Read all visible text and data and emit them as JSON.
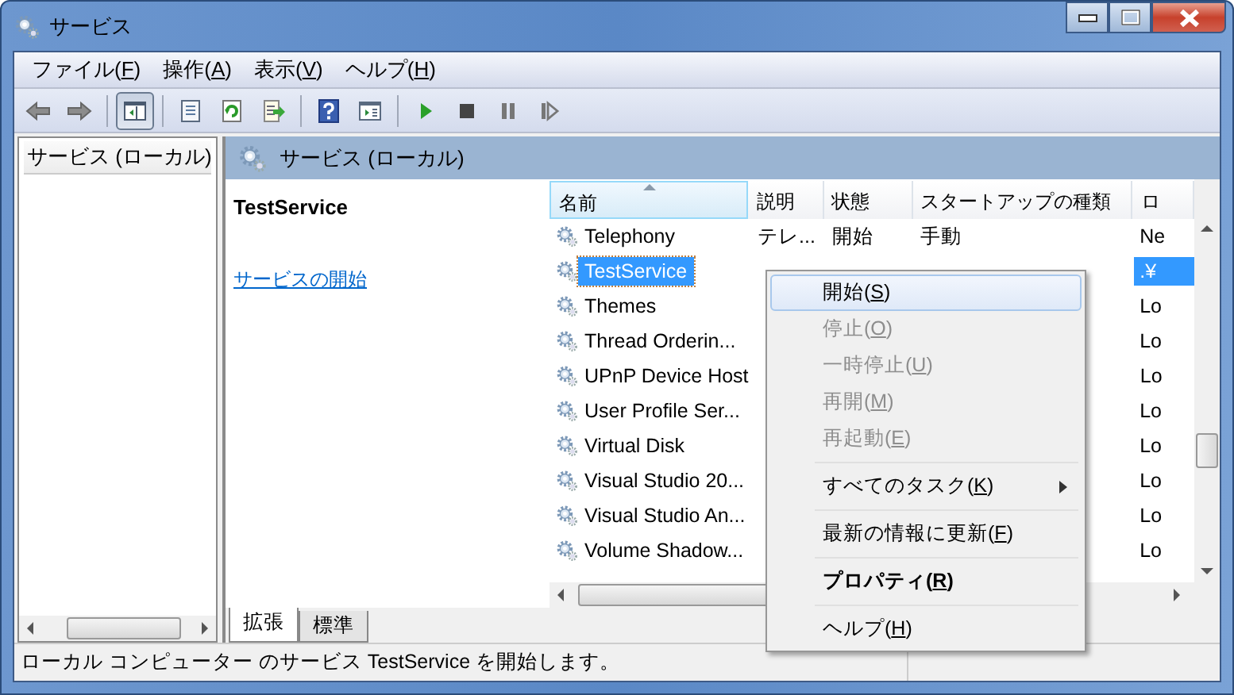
{
  "window": {
    "title": "サービス"
  },
  "menu_bar": [
    {
      "parts": [
        "ファイル(",
        "F",
        ")"
      ]
    },
    {
      "parts": [
        "操作(",
        "A",
        ")"
      ]
    },
    {
      "parts": [
        "表示(",
        "V",
        ")"
      ]
    },
    {
      "parts": [
        "ヘルプ(",
        "H",
        ")"
      ]
    }
  ],
  "toolbar": [
    {
      "kind": "back",
      "pressed": false
    },
    {
      "kind": "forward",
      "pressed": false
    },
    {
      "kind": "separator"
    },
    {
      "kind": "tree",
      "pressed": true
    },
    {
      "kind": "separator"
    },
    {
      "kind": "properties",
      "pressed": false
    },
    {
      "kind": "refresh",
      "pressed": false
    },
    {
      "kind": "export",
      "pressed": false
    },
    {
      "kind": "separator"
    },
    {
      "kind": "help",
      "pressed": false
    },
    {
      "kind": "view",
      "pressed": false
    },
    {
      "kind": "separator"
    },
    {
      "kind": "start",
      "pressed": false
    },
    {
      "kind": "stop",
      "pressed": false
    },
    {
      "kind": "pause",
      "pressed": false
    },
    {
      "kind": "resume",
      "pressed": false
    }
  ],
  "tree": {
    "items": [
      {
        "label": "サービス (ローカル)"
      }
    ]
  },
  "pane": {
    "header": "サービス (ローカル)",
    "service_name": "TestService",
    "link": "サービスの開始"
  },
  "table": {
    "columns": [
      {
        "label": "名前",
        "sorted": true
      },
      {
        "label": "説明",
        "sorted": false
      },
      {
        "label": "状態",
        "sorted": false
      },
      {
        "label": "スタートアップの種類",
        "sorted": false
      },
      {
        "label": "ロ",
        "sorted": false
      }
    ],
    "rows": [
      {
        "name": "Telephony",
        "description": "テレ...",
        "status": "開始",
        "startup": "手動",
        "log_on_as": "Ne",
        "selected": false
      },
      {
        "name": "TestService",
        "log_on_as": ".¥",
        "selected": true
      },
      {
        "name": "Themes",
        "log_on_as": "Lo",
        "selected": false
      },
      {
        "name": "Thread Orderin...",
        "log_on_as": "Lo",
        "selected": false
      },
      {
        "name": "UPnP Device Host",
        "log_on_as": "Lo",
        "selected": false
      },
      {
        "name": "User Profile Ser...",
        "log_on_as": "Lo",
        "selected": false
      },
      {
        "name": "Virtual Disk",
        "log_on_as": "Lo",
        "selected": false
      },
      {
        "name": "Visual Studio 20...",
        "log_on_as": "Lo",
        "selected": false
      },
      {
        "name": "Visual Studio An...",
        "log_on_as": "Lo",
        "selected": false
      },
      {
        "name": "Volume Shadow...",
        "log_on_as": "Lo",
        "selected": false
      }
    ]
  },
  "tabs": [
    {
      "label": "拡張",
      "selected": true
    },
    {
      "label": "標準",
      "selected": false
    }
  ],
  "context_menu": {
    "items": [
      {
        "kind": "item",
        "parts": [
          "開始(",
          "S",
          ")"
        ],
        "selected": true,
        "disabled": false,
        "default": false,
        "submenu": false
      },
      {
        "kind": "item",
        "parts": [
          "停止(",
          "O",
          ")"
        ],
        "selected": false,
        "disabled": true,
        "default": false,
        "submenu": false
      },
      {
        "kind": "item",
        "parts": [
          "一時停止(",
          "U",
          ")"
        ],
        "selected": false,
        "disabled": true,
        "default": false,
        "submenu": false
      },
      {
        "kind": "item",
        "parts": [
          "再開(",
          "M",
          ")"
        ],
        "selected": false,
        "disabled": true,
        "default": false,
        "submenu": false
      },
      {
        "kind": "item",
        "parts": [
          "再起動(",
          "E",
          ")"
        ],
        "selected": false,
        "disabled": true,
        "default": false,
        "submenu": false
      },
      {
        "kind": "separator"
      },
      {
        "kind": "item",
        "parts": [
          "すべてのタスク(",
          "K",
          ")"
        ],
        "selected": false,
        "disabled": false,
        "default": false,
        "submenu": true
      },
      {
        "kind": "separator"
      },
      {
        "kind": "item",
        "parts": [
          "最新の情報に更新(",
          "F",
          ")"
        ],
        "selected": false,
        "disabled": false,
        "default": false,
        "submenu": false
      },
      {
        "kind": "separator"
      },
      {
        "kind": "item",
        "parts": [
          "プロパティ(",
          "R",
          ")"
        ],
        "selected": false,
        "disabled": false,
        "default": true,
        "submenu": false
      },
      {
        "kind": "separator"
      },
      {
        "kind": "item",
        "parts": [
          "ヘルプ(",
          "H",
          ")"
        ],
        "selected": false,
        "disabled": false,
        "default": false,
        "submenu": false
      }
    ]
  },
  "status_bar": {
    "text": "ローカル コンピューター のサービス TestService を開始します。"
  }
}
